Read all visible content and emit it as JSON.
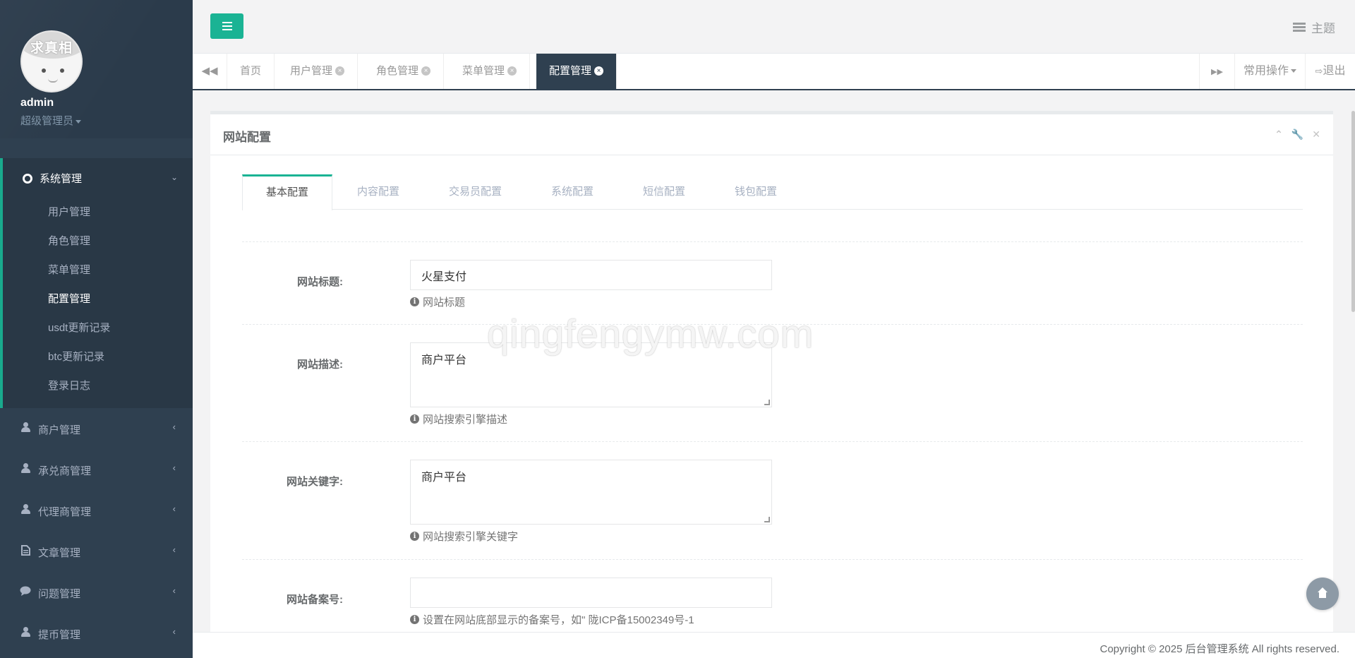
{
  "sidebar": {
    "avatar_text": "求真相",
    "username": "admin",
    "role": "超级管理员",
    "open_group": {
      "label": "系统管理",
      "items": [
        {
          "label": "用户管理"
        },
        {
          "label": "角色管理"
        },
        {
          "label": "菜单管理"
        },
        {
          "label": "配置管理"
        },
        {
          "label": "usdt更新记录"
        },
        {
          "label": "btc更新记录"
        },
        {
          "label": "登录日志"
        }
      ]
    },
    "groups": [
      {
        "label": "商户管理",
        "icon": "user-icon"
      },
      {
        "label": "承兑商管理",
        "icon": "user-icon"
      },
      {
        "label": "代理商管理",
        "icon": "user-icon"
      },
      {
        "label": "文章管理",
        "icon": "file-icon"
      },
      {
        "label": "问题管理",
        "icon": "comment-icon"
      },
      {
        "label": "提币管理",
        "icon": "user-icon"
      }
    ]
  },
  "topbar": {
    "theme_label": "主题"
  },
  "tabstrip": {
    "tabs": [
      {
        "label": "首页"
      },
      {
        "label": "用户管理"
      },
      {
        "label": "角色管理"
      },
      {
        "label": "菜单管理"
      },
      {
        "label": "配置管理"
      }
    ],
    "close_glyph": "×",
    "common_ops": "常用操作",
    "logout": "退出"
  },
  "panel": {
    "title": "网站配置",
    "tabs": [
      {
        "label": "基本配置"
      },
      {
        "label": "内容配置"
      },
      {
        "label": "交易员配置"
      },
      {
        "label": "系统配置"
      },
      {
        "label": "短信配置"
      },
      {
        "label": "钱包配置"
      }
    ],
    "fields": [
      {
        "label": "网站标题:",
        "value": "火星支付",
        "help": "网站标题"
      },
      {
        "label": "网站描述:",
        "value": "商户平台",
        "help": "网站搜索引擎描述"
      },
      {
        "label": "网站关键字:",
        "value": "商户平台",
        "help": "网站搜索引擎关键字"
      },
      {
        "label": "网站备案号:",
        "value": "",
        "help": "设置在网站底部显示的备案号，如\" 陇ICP备15002349号-1"
      }
    ]
  },
  "watermark": "qingfengymw.com",
  "footer": "Copyright © 2025 后台管理系统 All rights reserved.",
  "colors": {
    "sidebar_bg": "#2f4050",
    "accent": "#1ab394",
    "active_tab_bg": "#2f4050"
  }
}
